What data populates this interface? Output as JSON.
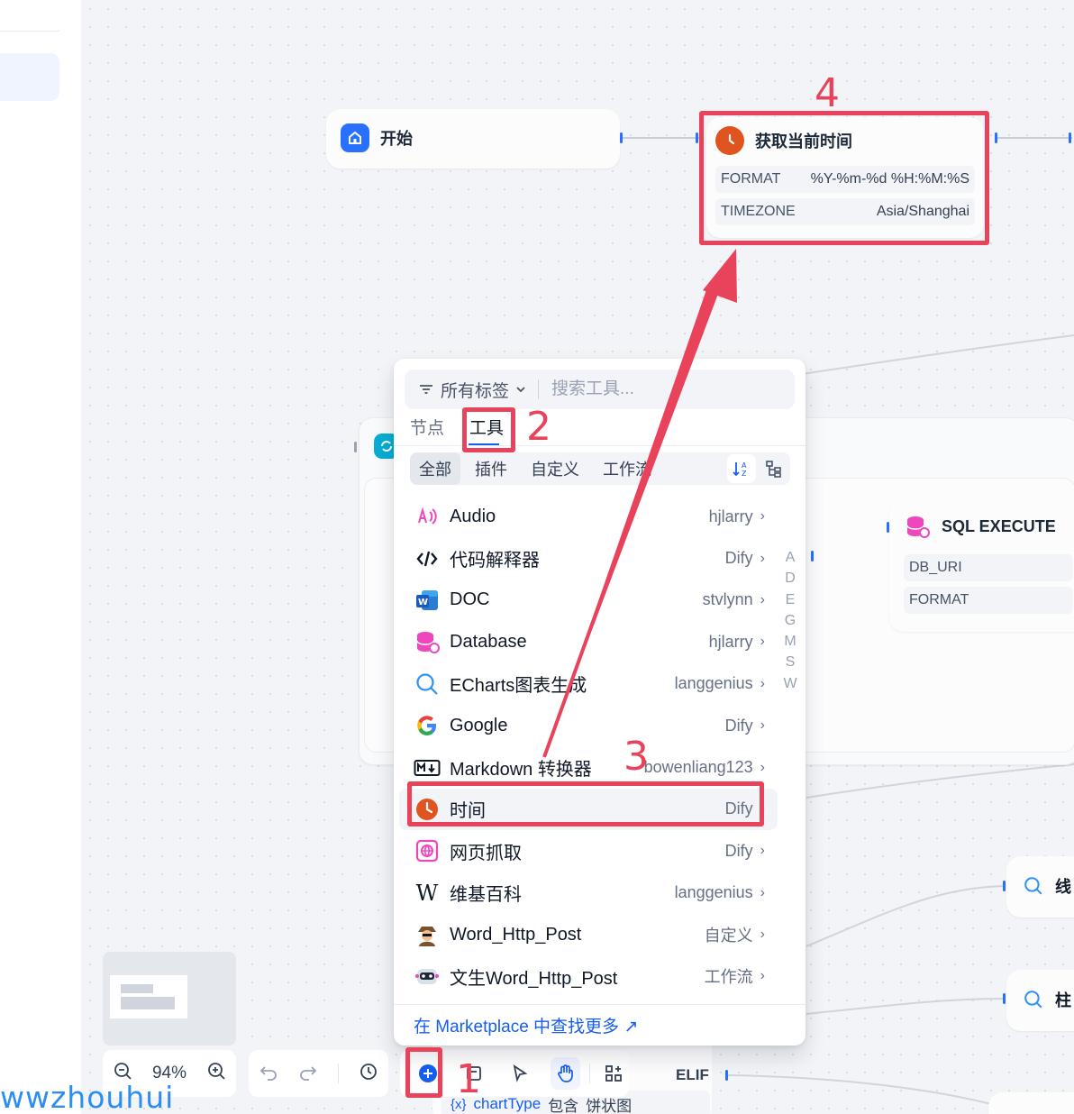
{
  "nodes": {
    "start": {
      "title": "开始"
    },
    "get_time": {
      "title": "获取当前时间",
      "params": [
        {
          "key": "FORMAT",
          "value": "%Y-%m-%d %H:%M:%S"
        },
        {
          "key": "TIMEZONE",
          "value": "Asia/Shanghai"
        }
      ]
    },
    "sql": {
      "title": "SQL EXECUTE",
      "params": [
        {
          "key": "DB_URI"
        },
        {
          "key": "FORMAT"
        }
      ]
    },
    "elif": {
      "label": "ELIF"
    },
    "condition": {
      "var": "{x}",
      "name": "chartType",
      "op": "包含",
      "value": "饼状图"
    },
    "right_partial_1": {
      "text": "线"
    },
    "right_partial_2": {
      "text": "柱"
    }
  },
  "tool_picker": {
    "tag_filter": "所有标签",
    "search_placeholder": "搜索工具...",
    "tabs": [
      "节点",
      "工具"
    ],
    "active_tab": "工具",
    "categories": [
      "全部",
      "插件",
      "自定义",
      "工作流"
    ],
    "active_category": "全部",
    "tools": [
      {
        "name": "Audio",
        "author": "hjlarry",
        "icon": "audio-icon"
      },
      {
        "name": "代码解释器",
        "author": "Dify",
        "icon": "code-icon"
      },
      {
        "name": "DOC",
        "author": "stvlynn",
        "icon": "word-icon"
      },
      {
        "name": "Database",
        "author": "hjlarry",
        "icon": "database-icon"
      },
      {
        "name": "ECharts图表生成",
        "author": "langgenius",
        "icon": "echarts-icon"
      },
      {
        "name": "Google",
        "author": "Dify",
        "icon": "google-icon"
      },
      {
        "name": "Markdown 转换器",
        "author": "bowenliang123",
        "icon": "markdown-icon"
      },
      {
        "name": "时间",
        "author": "Dify",
        "icon": "clock-icon"
      },
      {
        "name": "网页抓取",
        "author": "Dify",
        "icon": "web-scrape-icon"
      },
      {
        "name": "维基百科",
        "author": "langgenius",
        "icon": "wikipedia-icon"
      },
      {
        "name": "Word_Http_Post",
        "author": "自定义",
        "icon": "detective-icon"
      },
      {
        "name": "文生Word_Http_Post",
        "author": "工作流",
        "icon": "robot-icon"
      }
    ],
    "alphabet_index": [
      "A",
      "D",
      "E",
      "G",
      "M",
      "S",
      "W"
    ],
    "marketplace_link": "在 Marketplace 中查找更多 ↗"
  },
  "zoom": {
    "level": "94%"
  },
  "annotations": [
    "1",
    "2",
    "3",
    "4"
  ],
  "watermark": "wwzhouhui",
  "colors": {
    "accent": "#155eef",
    "annotation": "#e8435a",
    "handle": "#2970ff"
  }
}
